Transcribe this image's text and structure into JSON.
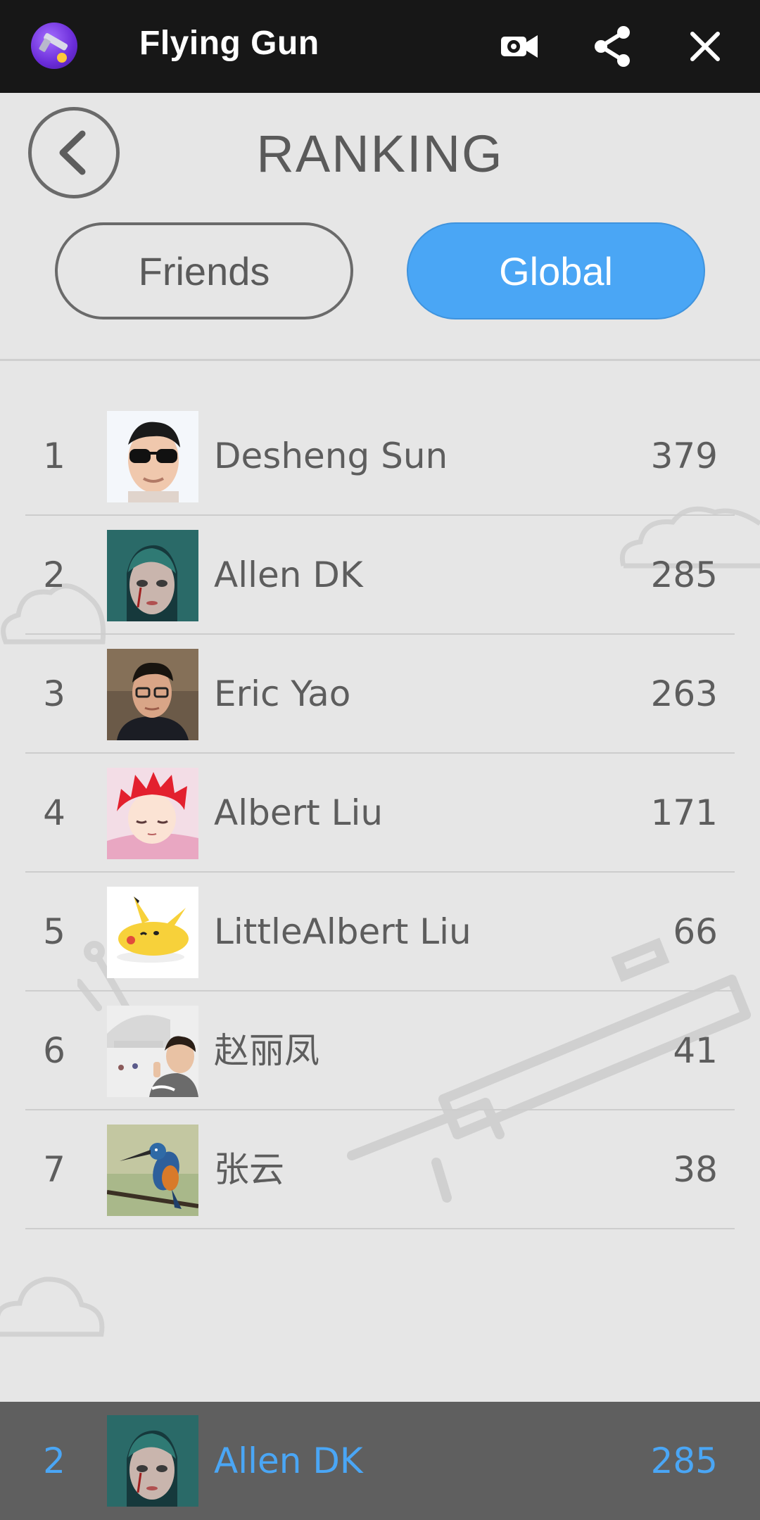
{
  "app": {
    "title": "Flying Gun",
    "icons": {
      "logo": "app-logo-icon",
      "record": "video-record-icon",
      "share": "share-icon",
      "close": "close-icon"
    }
  },
  "page": {
    "title": "RANKING",
    "back_icon": "chevron-left-icon"
  },
  "tabs": [
    {
      "label": "Friends",
      "active": false
    },
    {
      "label": "Global",
      "active": true
    }
  ],
  "colors": {
    "accent": "#4aa6f5",
    "background": "#e6e6e6",
    "text": "#5d5d5d",
    "topbar": "#171717",
    "my_rank_bar": "#5f5f5f"
  },
  "rankings": [
    {
      "rank": "1",
      "name": "Desheng Sun",
      "score": "379",
      "avatar": "avatar-sunglasses-man"
    },
    {
      "rank": "2",
      "name": "Allen DK",
      "score": "285",
      "avatar": "avatar-teal-hair-girl"
    },
    {
      "rank": "3",
      "name": "Eric Yao",
      "score": "263",
      "avatar": "avatar-glasses-man"
    },
    {
      "rank": "4",
      "name": "Albert Liu",
      "score": "171",
      "avatar": "avatar-red-hair-anime"
    },
    {
      "rank": "5",
      "name": "LittleAlbert Liu",
      "score": "66",
      "avatar": "avatar-pikachu"
    },
    {
      "rank": "6",
      "name": "赵丽凤",
      "score": "41",
      "avatar": "avatar-selfie"
    },
    {
      "rank": "7",
      "name": "张云",
      "score": "38",
      "avatar": "avatar-kingfisher-bird"
    }
  ],
  "my_rank": {
    "rank": "2",
    "name": "Allen DK",
    "score": "285",
    "avatar": "avatar-teal-hair-girl"
  }
}
